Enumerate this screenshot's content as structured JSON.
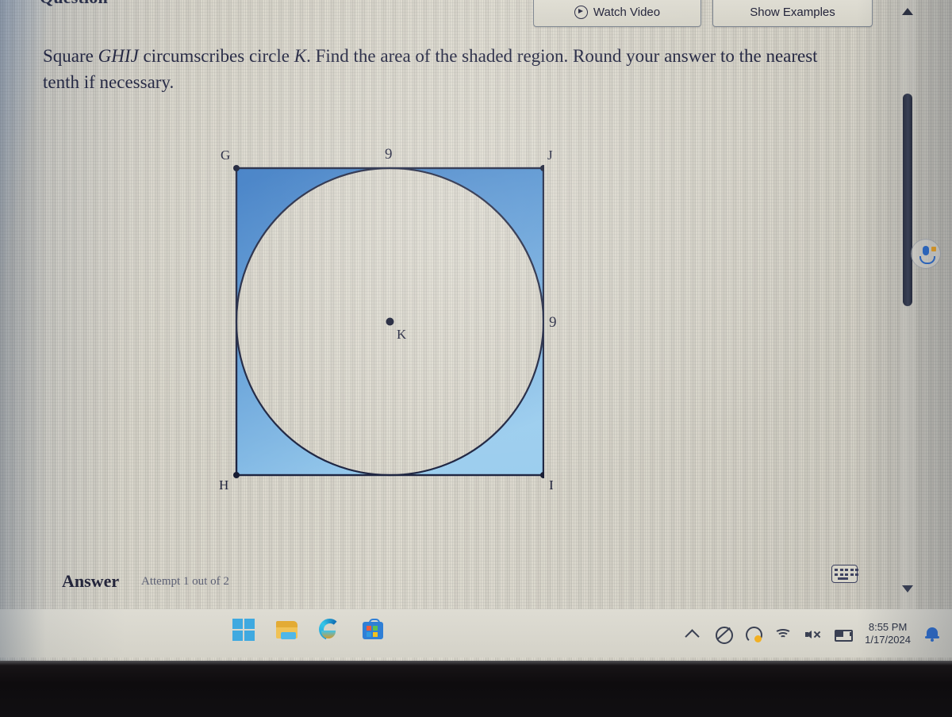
{
  "app": {
    "section_title": "Question",
    "prompt_line1_pre": "Square ",
    "prompt_line1_italic1": "GHIJ",
    "prompt_line1_mid": " circumscribes circle ",
    "prompt_line1_italic2": "K",
    "prompt_line1_post": ". Find the area of the shaded region. Round your",
    "prompt_line2": "answer to the nearest tenth if necessary."
  },
  "toolbar": {
    "watch_video_label": "Watch Video",
    "show_examples_label": "Show Examples",
    "play_icon": "play-circle-icon"
  },
  "figure": {
    "vertex_top_left": "G",
    "vertex_top_right": "J",
    "vertex_bottom_right": "I",
    "vertex_bottom_left": "H",
    "center_label": "K",
    "top_side_length": "9",
    "right_side_length": "9",
    "shade_color_dark": "#3b7cc4",
    "shade_color_light": "#93c8e9",
    "stroke_color": "#1d2440",
    "circle_fill": "#dedbd0"
  },
  "answer": {
    "label": "Answer",
    "attempt_text": "Attempt 1 out of 2",
    "keypad_icon": "keypad-icon"
  },
  "mic": {
    "icon": "microphone-icon"
  },
  "scrollbar": {
    "up_icon": "scroll-up-arrow-icon",
    "down_icon": "scroll-down-arrow-icon"
  },
  "taskbar": {
    "items": [
      {
        "name": "start-button",
        "icon": "windows-logo-icon"
      },
      {
        "name": "file-explorer",
        "icon": "file-explorer-icon"
      },
      {
        "name": "edge-browser",
        "icon": "edge-icon"
      },
      {
        "name": "microsoft-store",
        "icon": "store-bag-icon"
      }
    ],
    "tray": {
      "overflow_icon": "chevron-up-icon",
      "pen_off_icon": "pen-disabled-icon",
      "sync_icon": "sync-warning-icon",
      "wifi_icon": "wifi-icon",
      "volume_icon": "volume-muted-icon",
      "battery_icon": "battery-icon",
      "time": "8:55 PM",
      "date": "1/17/2024",
      "notification_icon": "bell-icon"
    }
  }
}
